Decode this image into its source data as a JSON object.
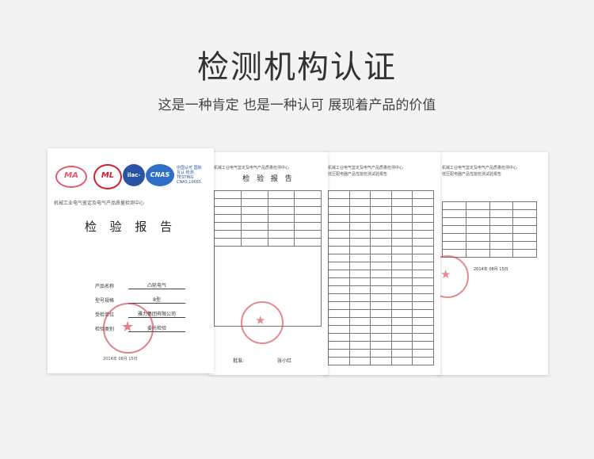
{
  "header": {
    "title": "检测机构认证",
    "subtitle": "这是一种肯定 也是一种认可 展现着产品的价值"
  },
  "report_cover": {
    "logos": {
      "ma": "MA",
      "ml": "ML",
      "iac": "ilac-MRA",
      "cnas": "CNAS",
      "cnas_caption": "中国认可 国际互认 检测 TESTING CNAS L0665"
    },
    "org_line": "机械工业电气鉴定及电气产品质量检测中心",
    "title": "检 验 报 告",
    "fields": [
      {
        "key": "产品名称",
        "value": "凸轮电气"
      },
      {
        "key": "型号规格",
        "value": "8型"
      },
      {
        "key": "受检单位",
        "value": "雅力集团有限公司"
      },
      {
        "key": "检验类别",
        "value": "委托检验"
      }
    ],
    "date": "2014年 08月 15日"
  },
  "report_page2": {
    "org_line": "机械工业电气鉴定及电气产品质量检测中心",
    "title": "检 验 报 告",
    "sign_label": "批准:",
    "sign": "张小红"
  },
  "report_page3": {
    "org_line": "机械工业电气鉴定及电气产品质量检测中心",
    "sub_line": "低压配电器产品性能检测试验报告"
  },
  "report_page4": {
    "org_line": "机械工业电气鉴定及电气产品质量检测中心",
    "sub_line": "低压配电器产品性能检测试验报告",
    "date": "2014年 08月 15日"
  }
}
